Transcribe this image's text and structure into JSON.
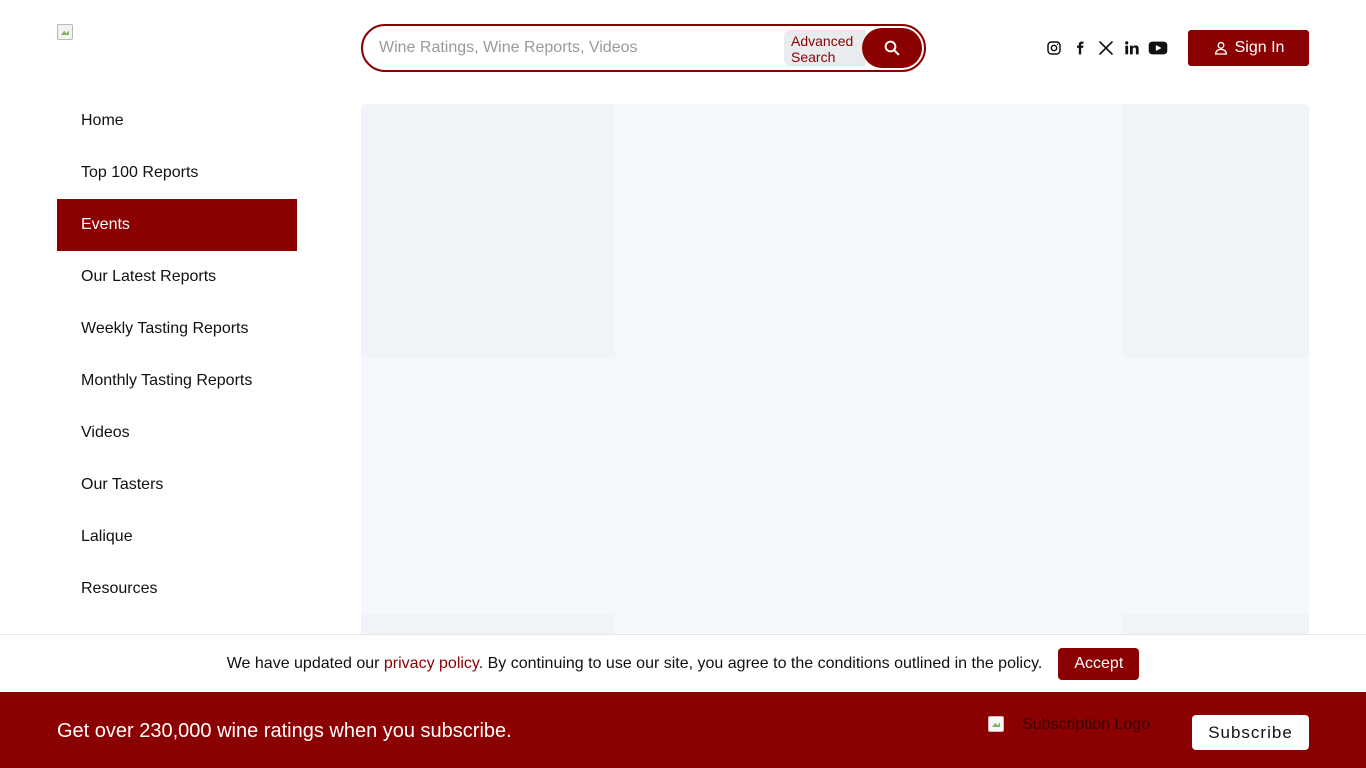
{
  "header": {
    "logo_icon": "broken-image-icon",
    "search": {
      "placeholder": "Wine Ratings, Wine Reports, Videos",
      "value": "",
      "advanced_line1": "Advanced",
      "advanced_line2": "Search",
      "button_icon": "search-icon"
    },
    "social": [
      {
        "name": "instagram-icon"
      },
      {
        "name": "facebook-icon"
      },
      {
        "name": "x-icon"
      },
      {
        "name": "linkedin-icon"
      },
      {
        "name": "youtube-icon"
      }
    ],
    "signin_label": "Sign In",
    "signin_icon": "user-icon"
  },
  "sidebar": {
    "items": [
      {
        "label": "Home",
        "active": false
      },
      {
        "label": "Top 100 Reports",
        "active": false
      },
      {
        "label": "Events",
        "active": true
      },
      {
        "label": "Our Latest Reports",
        "active": false
      },
      {
        "label": "Weekly Tasting Reports",
        "active": false
      },
      {
        "label": "Monthly Tasting Reports",
        "active": false
      },
      {
        "label": "Videos",
        "active": false
      },
      {
        "label": "Our Tasters",
        "active": false
      },
      {
        "label": "Lalique",
        "active": false
      },
      {
        "label": "Resources",
        "active": false
      }
    ]
  },
  "cookie": {
    "text_before": "We have updated our ",
    "link_text": "privacy policy",
    "text_after": ". By continuing to use our site, you agree to the conditions outlined in the policy.",
    "accept_label": "Accept"
  },
  "subscribe": {
    "text": "Get over 230,000 wine ratings when you subscribe.",
    "logo_alt": "Subscription Logo",
    "button_label": "Subscribe"
  },
  "colors": {
    "brand": "#8b0000",
    "panel": "#f3f6fa"
  }
}
